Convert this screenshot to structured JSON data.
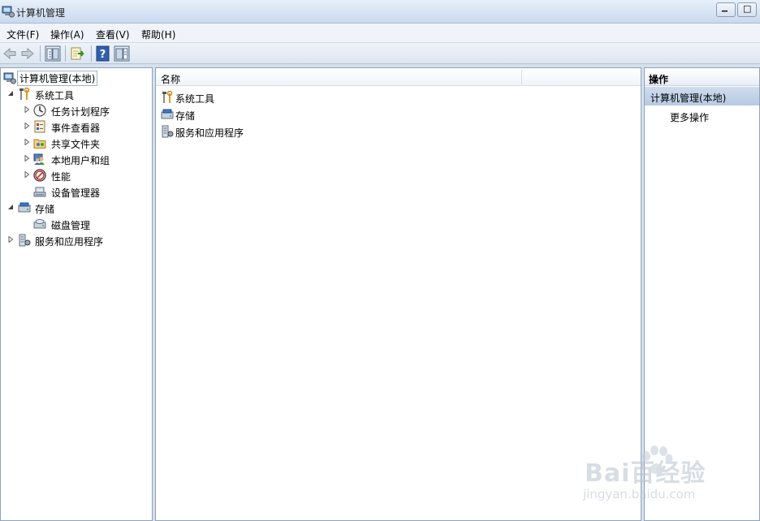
{
  "window": {
    "title": "计算机管理",
    "minimize_glyph": "▁",
    "maximize_glyph": "□"
  },
  "menu": [
    {
      "label": "文件(F)"
    },
    {
      "label": "操作(A)"
    },
    {
      "label": "查看(V)"
    },
    {
      "label": "帮助(H)"
    }
  ],
  "toolbar": [
    "back-icon",
    "forward-icon",
    "show-hide-tree-icon",
    "export-list-icon",
    "help-icon",
    "show-hide-action-pane-icon"
  ],
  "tree": {
    "root": {
      "label": "计算机管理(本地)",
      "icon": "computer-management-icon"
    },
    "items": [
      {
        "label": "系统工具",
        "icon": "tools-icon",
        "expanded": true
      },
      {
        "label": "任务计划程序",
        "icon": "clock-icon"
      },
      {
        "label": "事件查看器",
        "icon": "event-viewer-icon"
      },
      {
        "label": "共享文件夹",
        "icon": "shared-folder-icon"
      },
      {
        "label": "本地用户和组",
        "icon": "users-icon"
      },
      {
        "label": "性能",
        "icon": "performance-icon"
      },
      {
        "label": "设备管理器",
        "icon": "device-manager-icon"
      },
      {
        "label": "存储",
        "icon": "storage-icon",
        "expanded": true
      },
      {
        "label": "磁盘管理",
        "icon": "disk-icon"
      },
      {
        "label": "服务和应用程序",
        "icon": "services-icon",
        "expanded": false
      }
    ]
  },
  "list": {
    "column": "名称",
    "rows": [
      {
        "label": "系统工具",
        "icon": "tools-icon"
      },
      {
        "label": "存储",
        "icon": "storage-icon"
      },
      {
        "label": "服务和应用程序",
        "icon": "services-icon"
      }
    ]
  },
  "actions": {
    "header": "操作",
    "section": "计算机管理(本地)",
    "items": [
      {
        "label": "更多操作"
      }
    ]
  },
  "watermark": {
    "brand": "Bai百经验",
    "url": "jingyan.baidu.com"
  },
  "colors": {
    "selection": "#cfdced",
    "accent": "#3c72b0"
  }
}
